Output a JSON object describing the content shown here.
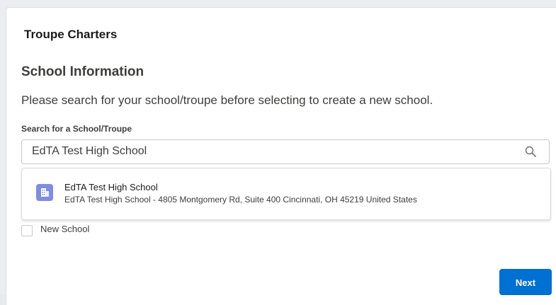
{
  "app": {
    "title": "Troupe Charters"
  },
  "section": {
    "title": "School Information",
    "instructions": "Please search for your school/troupe before selecting to create a new school."
  },
  "search": {
    "label": "Search for a School/Troupe",
    "value": "EdTA Test High School",
    "icon": "search-icon"
  },
  "results": [
    {
      "icon": "building-icon",
      "title": "EdTA Test High School",
      "subtitle": "EdTA Test High School - 4805 Montgomery Rd, Suite 400 Cincinnati, OH 45219 United States"
    }
  ],
  "new_school": {
    "label": "New School",
    "checked": false
  },
  "actions": {
    "next_label": "Next"
  },
  "colors": {
    "accent": "#0070d2",
    "avatar": "#7f8de1",
    "text": "#3e3e3c"
  }
}
